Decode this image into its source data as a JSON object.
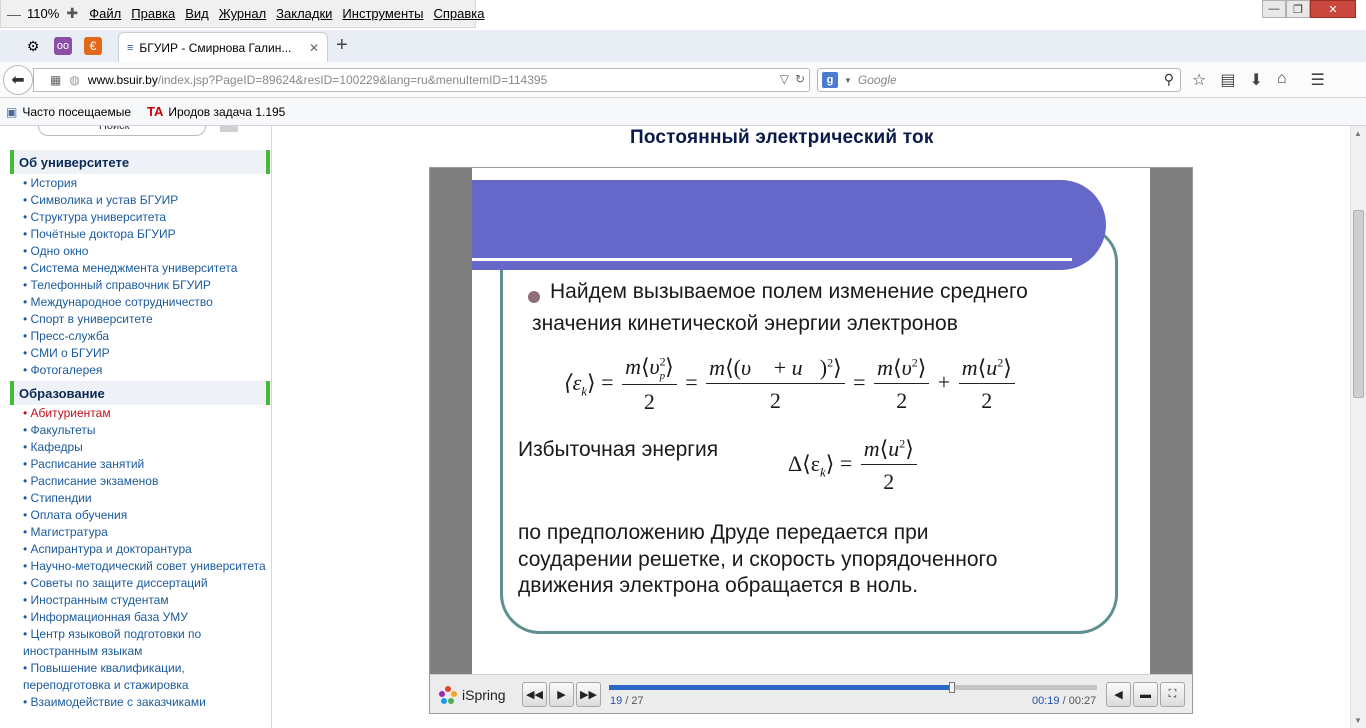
{
  "window": {
    "zoom": "110%"
  },
  "menubar": {
    "items": [
      "Файл",
      "Правка",
      "Вид",
      "Журнал",
      "Закладки",
      "Инструменты",
      "Справка"
    ]
  },
  "tabs": [
    {
      "title": "БГУИР - Смирнова Галин..."
    }
  ],
  "navbar": {
    "url_domain": "www.bsuir.by",
    "url_path": "/index.jsp?PageID=89624&resID=100229&lang=ru&menuItemID=114395",
    "search_placeholder": "Google"
  },
  "bookmarks": [
    {
      "label": "Часто посещаемые"
    },
    {
      "label": "Иродов задача 1.195"
    }
  ],
  "sidebar": {
    "search_label": "Поиск",
    "sections": [
      {
        "title": "Об университете",
        "items": [
          "История",
          "Символика и устав БГУИР",
          "Структура университета",
          "Почётные доктора БГУИР",
          "Одно окно",
          "Система менеджмента университета",
          "Телефонный справочник БГУИР",
          "Международное сотрудничество",
          "Спорт в университете",
          "Пресс-служба",
          "СМИ о БГУИР",
          "Фотогалерея"
        ]
      },
      {
        "title": "Образование",
        "items": [
          "Абитуриентам",
          "Факультеты",
          "Кафедры",
          "Расписание занятий",
          "Расписание экзаменов",
          "Стипендии",
          "Оплата обучения",
          "Магистратура",
          "Аспирантура и докторантура",
          "Научно-методический совет университета",
          "Советы по защите диссертаций",
          "Иностранным студентам",
          "Информационная база УМУ",
          "Центр языковой подготовки по иностранным языкам",
          "Повышение квалификации, переподготовка и стажировка",
          "Взаимодействие с заказчиками"
        ],
        "active_item": "Абитуриентам"
      }
    ]
  },
  "page": {
    "heading": "Постоянный электрический ток"
  },
  "slide": {
    "bullet_line1": "Найдем вызываемое полем изменение среднего",
    "bullet_line2": "значения кинетической энергии электронов",
    "excess_label": "Избыточная энергия",
    "para_line1": "по предположению Друде передается при",
    "para_line2": "соударении решетке, и скорость упорядоченного",
    "para_line3": "движения электрона обращается в ноль.",
    "formula1_lhs": "⟨ε",
    "formula1_lhs_sub": "k",
    "formula_m": "m",
    "formula_two": "2",
    "formula_excess_prefix": "Δ⟨ε"
  },
  "player": {
    "logo": "iSpring",
    "current_slide": "19",
    "total_slides": "27",
    "time_current": "00:19",
    "time_total": "00:27",
    "progress": 0.703
  },
  "colors": {
    "slide_header": "#6567c9",
    "slide_border": "#5f8f8f",
    "nav_accent": "#45b93a",
    "progress": "#2e66c6"
  }
}
